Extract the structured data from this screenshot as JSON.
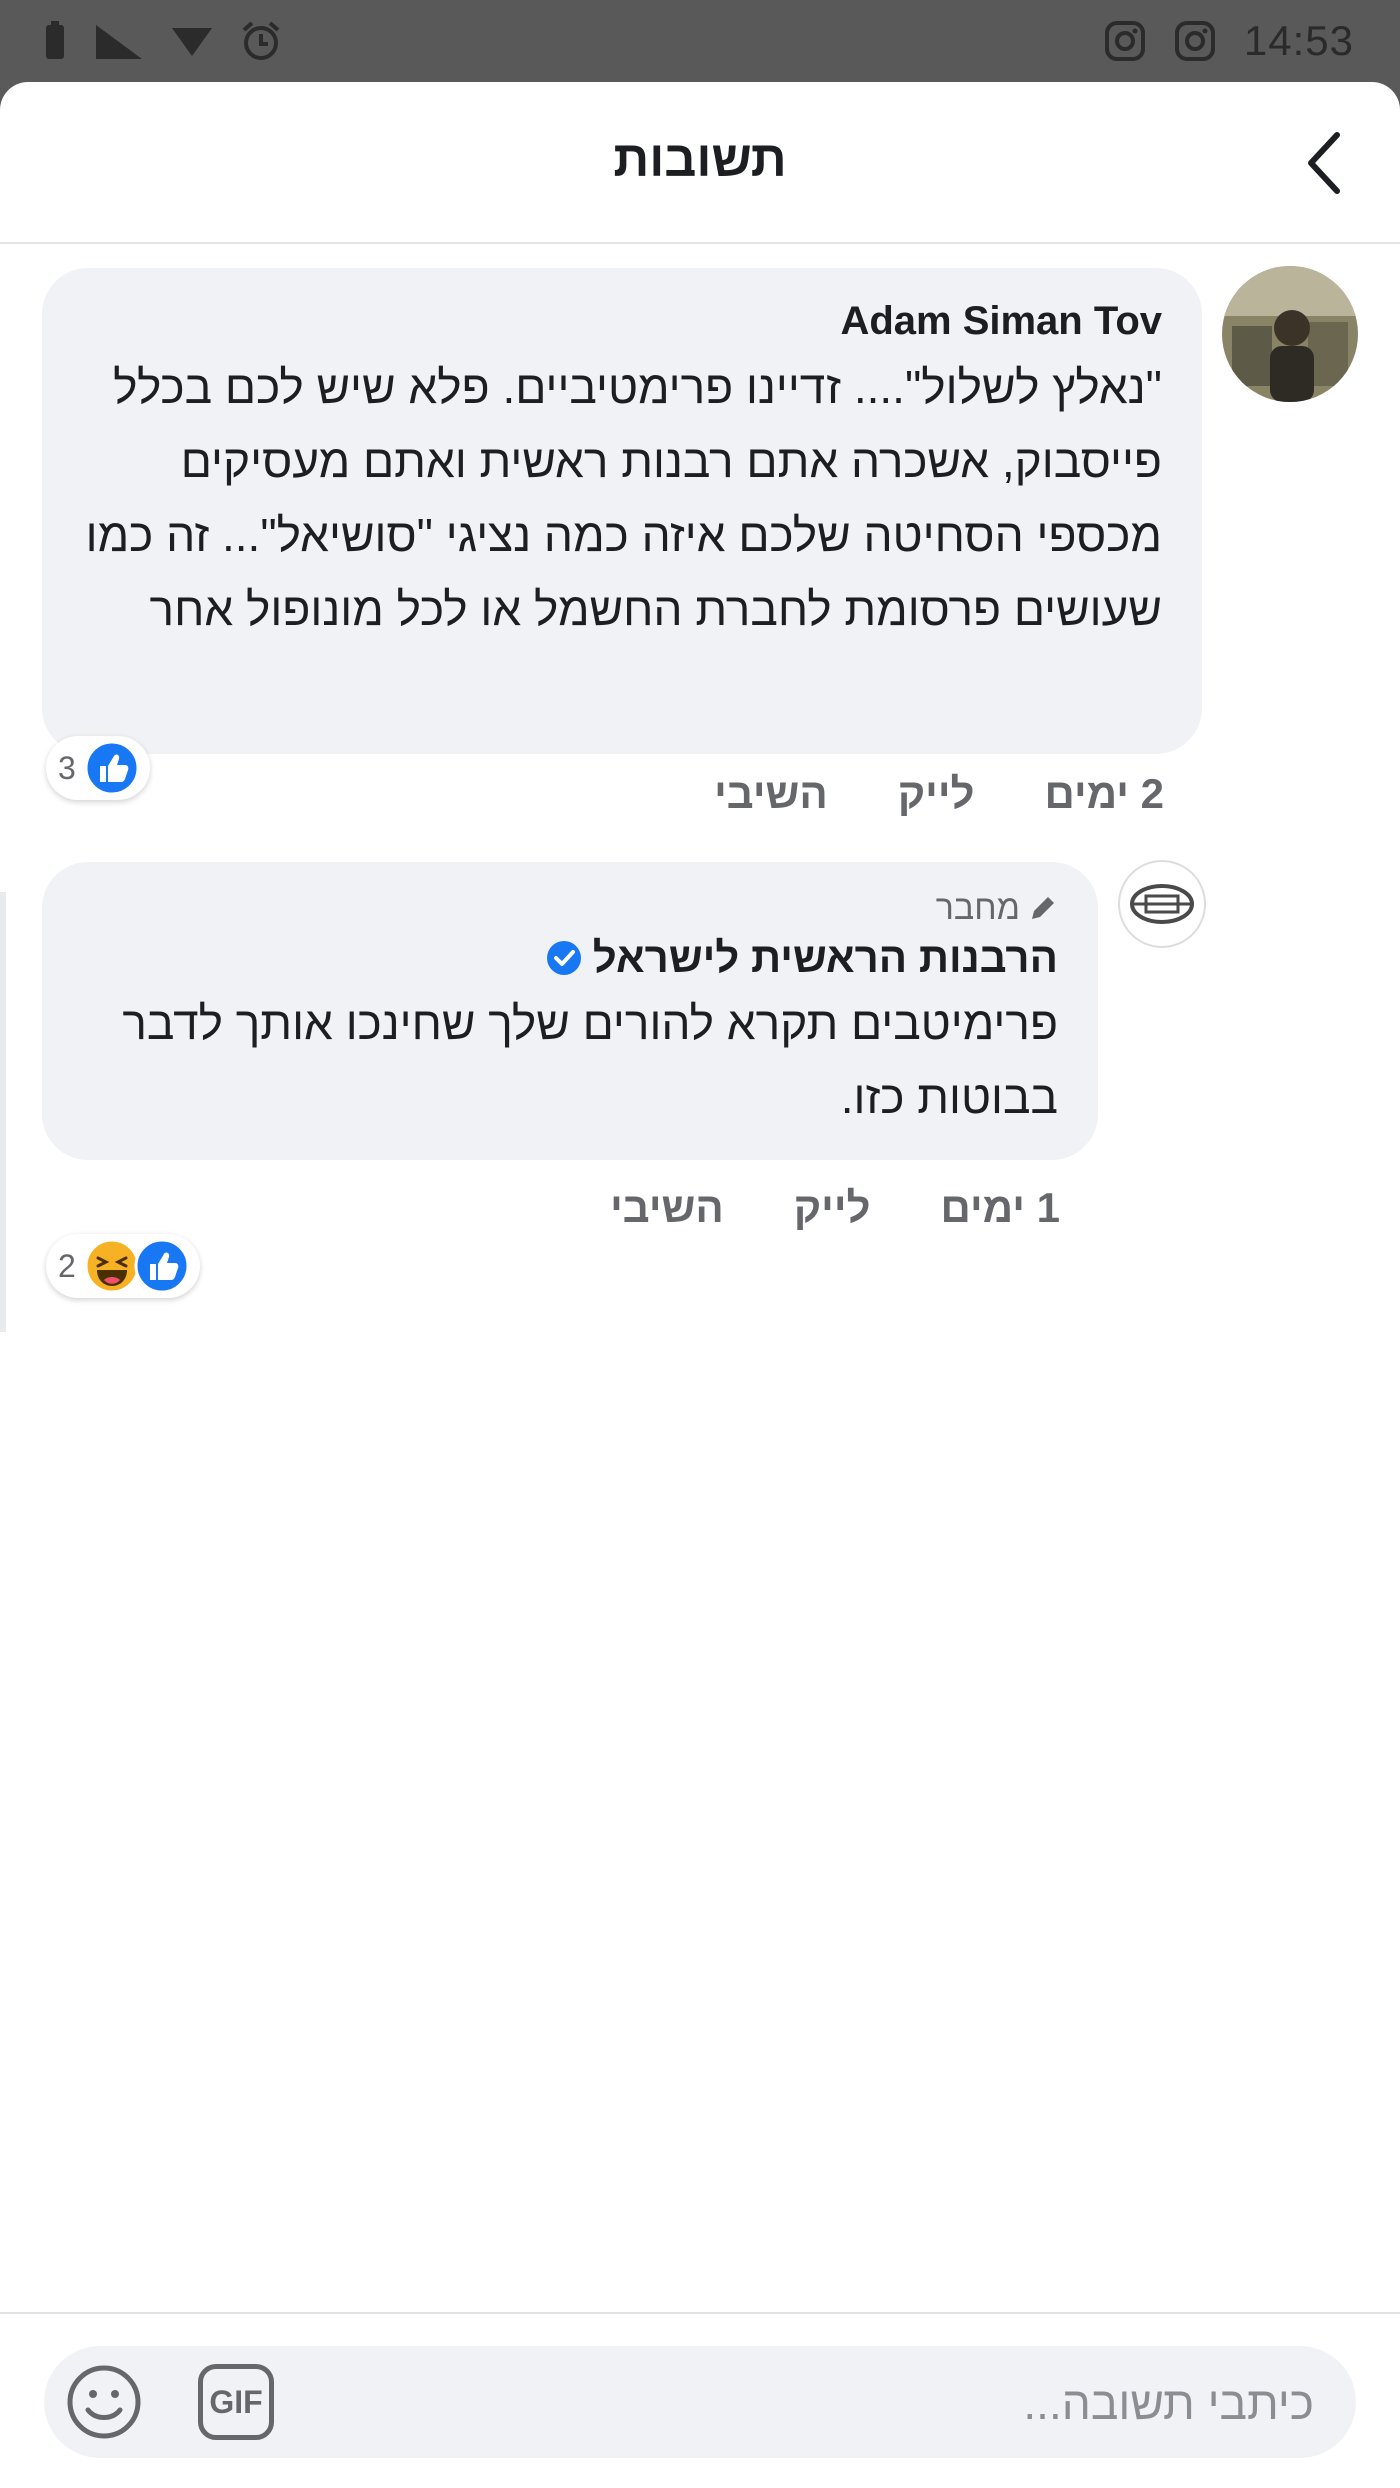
{
  "status_bar": {
    "time": "14:53",
    "icons": [
      "battery-icon",
      "signal-icon",
      "wifi-icon",
      "alarm-icon",
      "instagram-icon",
      "instagram-icon"
    ]
  },
  "header": {
    "title": "תשובות",
    "back_icon": "chevron-right-icon"
  },
  "comments": [
    {
      "author": "Adam Siman Tov",
      "text": "\"נאלץ לשלול\".... זדיינו פרימטיביים. פלא שיש לכם בכלל פייסבוק, אשכרה אתם רבנות ראשית ואתם מעסיקים מכספי הסחיטה שלכם איזה כמה נציגי \"סושיאל\"... זה כמו שעושים פרסומת לחברת החשמל או לכל מונופול אחר",
      "time": "2 ימים",
      "like_label": "לייק",
      "reply_label": "השיבי",
      "reaction_count": "3",
      "reactions": [
        "like-icon"
      ]
    },
    {
      "badge": "מחבר",
      "author": "הרבנות הראשית לישראל",
      "verified": true,
      "text": "פרימיטבים תקרא להורים שלך שחינכו אותך לדבר בבוטות כזו.",
      "time": "1 ימים",
      "like_label": "לייק",
      "reply_label": "השיבי",
      "reaction_count": "2",
      "reactions": [
        "like-icon",
        "haha-icon"
      ]
    }
  ],
  "composer": {
    "placeholder": "כיתבי תשובה...",
    "gif_label": "GIF",
    "emoji_icon": "smiley-icon"
  },
  "colors": {
    "accent": "#1877f2",
    "bubble": "#f0f2f5",
    "secondary_text": "#65676b"
  }
}
